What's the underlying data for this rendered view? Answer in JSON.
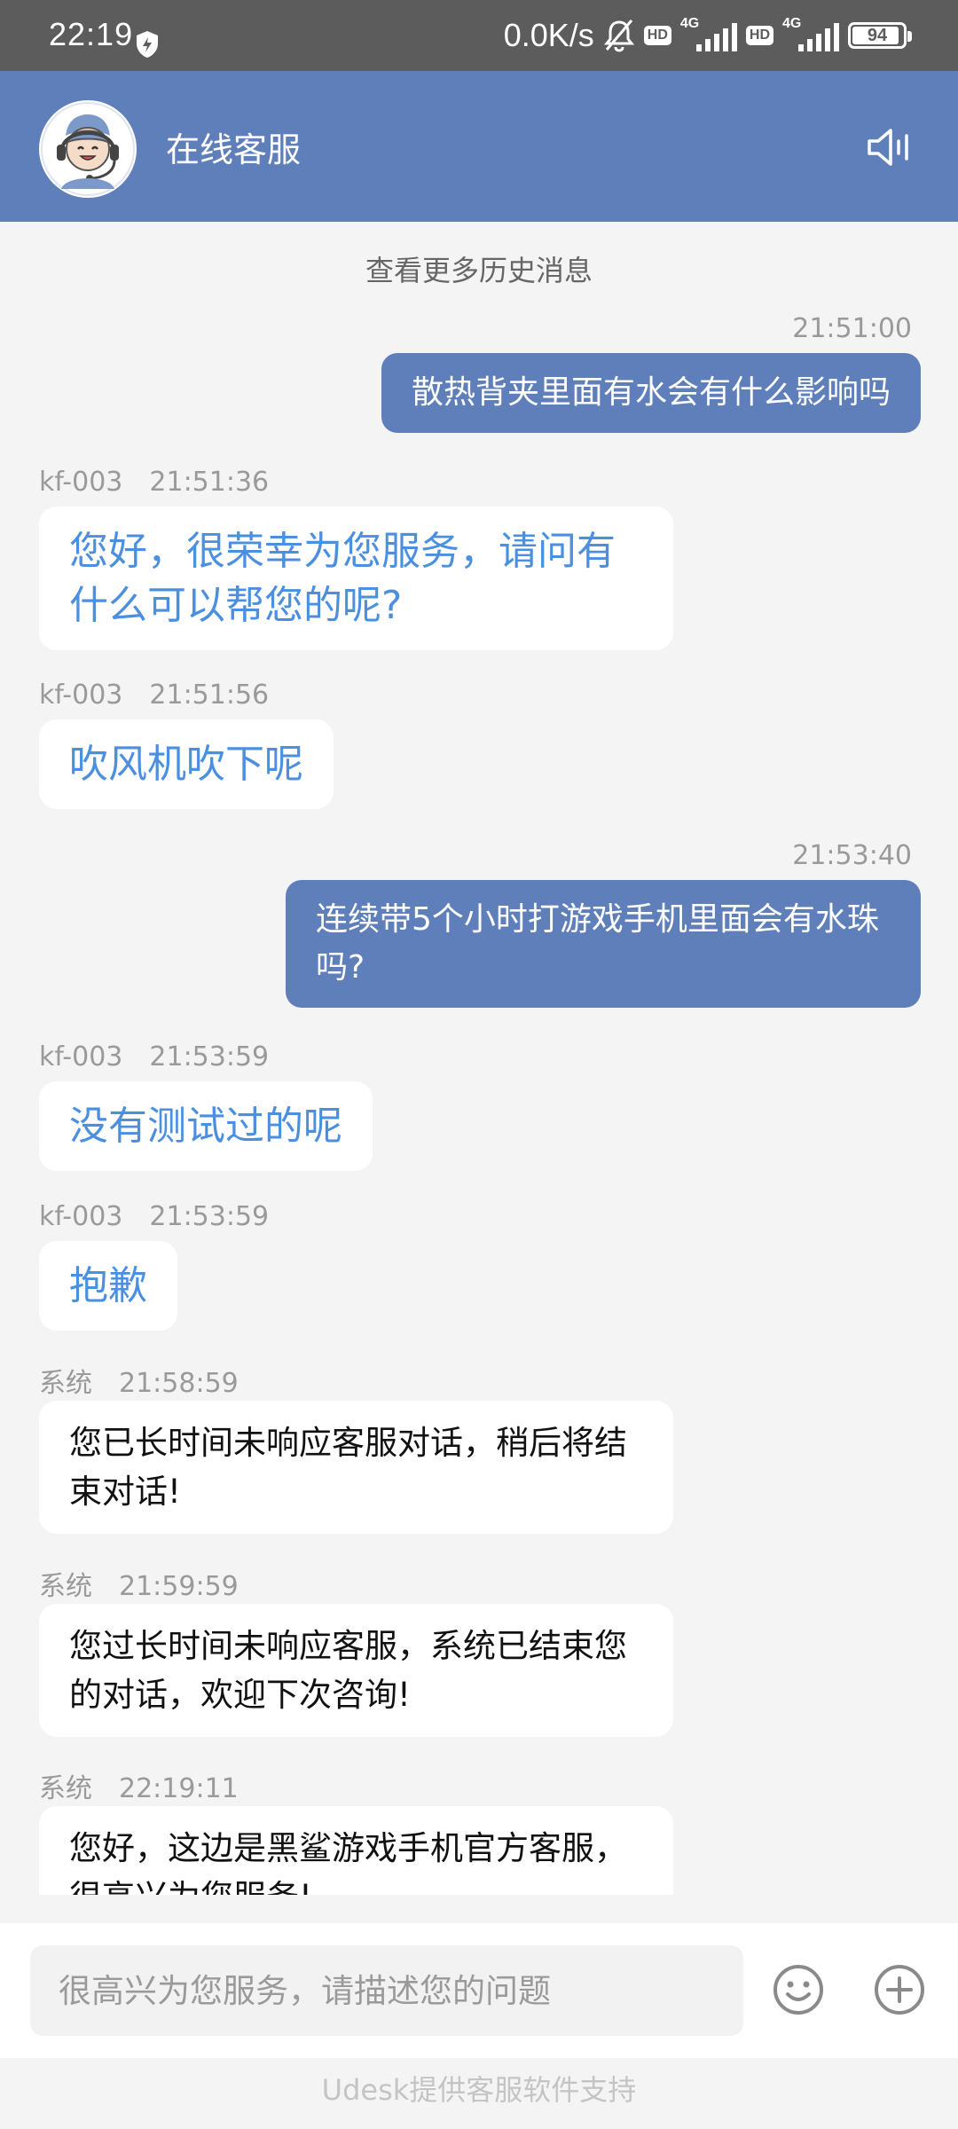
{
  "status_bar": {
    "time": "22:19",
    "net_speed": "0.0K/s",
    "hd_label": "HD",
    "network_label": "4G",
    "battery": "94"
  },
  "header": {
    "title": "在线客服"
  },
  "chat": {
    "history_link": "查看更多历史消息",
    "messages": [
      {
        "side": "right",
        "time": "21:51:00",
        "text": "散热背夹里面有水会有什么影响吗"
      },
      {
        "side": "left",
        "sender": "kf-003",
        "time": "21:51:36",
        "text": "您好，很荣幸为您服务，请问有什么可以帮您的呢?"
      },
      {
        "side": "left",
        "sender": "kf-003",
        "time": "21:51:56",
        "text": "吹风机吹下呢"
      },
      {
        "side": "right",
        "time": "21:53:40",
        "text": "连续带5个小时打游戏手机里面会有水珠吗?"
      },
      {
        "side": "left",
        "sender": "kf-003",
        "time": "21:53:59",
        "text": "没有测试过的呢"
      },
      {
        "side": "left",
        "sender": "kf-003",
        "time": "21:53:59",
        "text": "抱歉"
      },
      {
        "side": "left",
        "sender": "系统",
        "time": "21:58:59",
        "text": "您已长时间未响应客服对话，稍后将结束对话!"
      },
      {
        "side": "left",
        "sender": "系统",
        "time": "21:59:59",
        "text": "您过长时间未响应客服，系统已结束您的对话，欢迎下次咨询!"
      },
      {
        "side": "left",
        "sender": "系统",
        "time": "22:19:11",
        "text": "您好，这边是黑鲨游戏手机官方客服，很高兴为您服务!"
      }
    ]
  },
  "input": {
    "placeholder": "很高兴为您服务，请描述您的问题"
  },
  "footer": {
    "text": "Udesk提供客服软件支持"
  },
  "colors": {
    "header_bg": "#5f7fba",
    "agent_text": "#4a8fe0",
    "user_bubble": "#5f7fba"
  },
  "icons": [
    "shield-icon",
    "mute-bell-icon",
    "signal-icon",
    "battery-icon",
    "agent-avatar",
    "speaker-icon",
    "emoji-icon",
    "plus-icon"
  ]
}
